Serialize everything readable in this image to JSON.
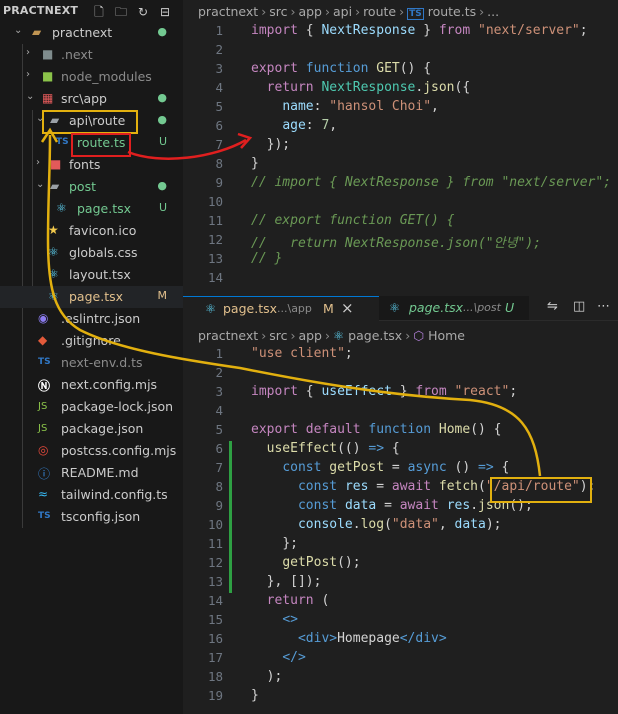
{
  "explorer": {
    "title": "PRACTNEXT",
    "actions": [
      "new-file-icon",
      "new-folder-icon",
      "refresh-icon",
      "collapse-icon"
    ],
    "items": [
      {
        "label": "practnext",
        "badge": "●",
        "kind": "folder-open"
      },
      {
        "label": ".next",
        "badge": "",
        "kind": "folder"
      },
      {
        "label": "node_modules",
        "badge": "",
        "kind": "folder"
      },
      {
        "label": "src\\app",
        "badge": "●",
        "kind": "folder-open"
      },
      {
        "label": "api\\route",
        "badge": "●",
        "kind": "folder-open"
      },
      {
        "label": "route.ts",
        "badge": "U",
        "kind": "ts"
      },
      {
        "label": "fonts",
        "badge": "",
        "kind": "folder"
      },
      {
        "label": "post",
        "badge": "●",
        "kind": "folder-open"
      },
      {
        "label": "page.tsx",
        "badge": "U",
        "kind": "react"
      },
      {
        "label": "favicon.ico",
        "badge": "",
        "kind": "star"
      },
      {
        "label": "globals.css",
        "badge": "",
        "kind": "css"
      },
      {
        "label": "layout.tsx",
        "badge": "",
        "kind": "react"
      },
      {
        "label": "page.tsx",
        "badge": "M",
        "kind": "react"
      },
      {
        "label": ".eslintrc.json",
        "badge": "",
        "kind": "eslint"
      },
      {
        "label": ".gitignore",
        "badge": "",
        "kind": "git"
      },
      {
        "label": "next-env.d.ts",
        "badge": "",
        "kind": "ts"
      },
      {
        "label": "next.config.mjs",
        "badge": "",
        "kind": "next"
      },
      {
        "label": "package-lock.json",
        "badge": "",
        "kind": "js"
      },
      {
        "label": "package.json",
        "badge": "",
        "kind": "js"
      },
      {
        "label": "postcss.config.mjs",
        "badge": "",
        "kind": "postcss"
      },
      {
        "label": "README.md",
        "badge": "",
        "kind": "info"
      },
      {
        "label": "tailwind.config.ts",
        "badge": "",
        "kind": "tailwind"
      },
      {
        "label": "tsconfig.json",
        "badge": "",
        "kind": "ts"
      }
    ]
  },
  "top_editor": {
    "breadcrumb": [
      "practnext",
      "src",
      "app",
      "api",
      "route",
      "route.ts",
      "..."
    ],
    "file_icon": "TS",
    "line_numbers": [
      "1",
      "2",
      "3",
      "4",
      "5",
      "6",
      "7",
      "8",
      "9",
      "10",
      "11",
      "12",
      "13",
      "14"
    ]
  },
  "tabs": [
    {
      "name": "page.tsx",
      "path": "...\\app",
      "status": "M",
      "close": "×"
    },
    {
      "name": "page.tsx",
      "path": "...\\post",
      "status": "U"
    }
  ],
  "tab_actions": [
    "compare-icon",
    "split-editor-icon",
    "more-actions-icon"
  ],
  "bottom_editor": {
    "breadcrumb": [
      "practnext",
      "src",
      "app",
      "page.tsx",
      "Home"
    ],
    "line_numbers": [
      "1",
      "2",
      "3",
      "4",
      "5",
      "6",
      "7",
      "8",
      "9",
      "10",
      "11",
      "12",
      "13",
      "14",
      "15",
      "16",
      "17",
      "18",
      "19"
    ]
  },
  "colors": {
    "highlight": "#e2b00f",
    "route_highlight": "#e01f1f",
    "arrow_yellow": "#e2b00f",
    "arrow_red": "#e01f1f",
    "ts_blue": "#3178c6",
    "react_blue": "#61dafb",
    "untracked": "#73c991",
    "modified": "#e2c08d"
  }
}
